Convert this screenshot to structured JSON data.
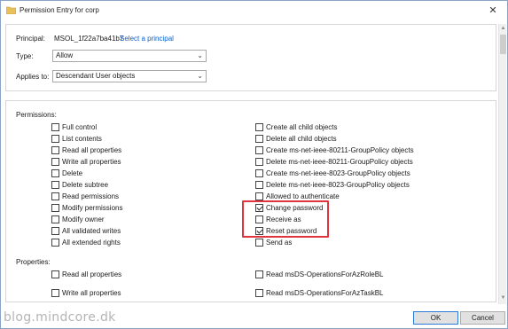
{
  "window": {
    "title": "Permission Entry for corp"
  },
  "principal": {
    "label": "Principal:",
    "value": "MSOL_1f22a7ba41b7",
    "link": "Select a principal"
  },
  "type": {
    "label": "Type:",
    "value": "Allow"
  },
  "applies_to": {
    "label": "Applies to:",
    "value": "Descendant User objects"
  },
  "permissions": {
    "heading": "Permissions:",
    "left": [
      {
        "label": "Full control",
        "checked": false
      },
      {
        "label": "List contents",
        "checked": false
      },
      {
        "label": "Read all properties",
        "checked": false
      },
      {
        "label": "Write all properties",
        "checked": false
      },
      {
        "label": "Delete",
        "checked": false
      },
      {
        "label": "Delete subtree",
        "checked": false
      },
      {
        "label": "Read permissions",
        "checked": false
      },
      {
        "label": "Modify permissions",
        "checked": false
      },
      {
        "label": "Modify owner",
        "checked": false
      },
      {
        "label": "All validated writes",
        "checked": false
      },
      {
        "label": "All extended rights",
        "checked": false
      }
    ],
    "right": [
      {
        "label": "Create all child objects",
        "checked": false
      },
      {
        "label": "Delete all child objects",
        "checked": false
      },
      {
        "label": "Create ms-net-ieee-80211-GroupPolicy objects",
        "checked": false
      },
      {
        "label": "Delete ms-net-ieee-80211-GroupPolicy objects",
        "checked": false
      },
      {
        "label": "Create ms-net-ieee-8023-GroupPolicy objects",
        "checked": false
      },
      {
        "label": "Delete ms-net-ieee-8023-GroupPolicy objects",
        "checked": false
      },
      {
        "label": "Allowed to authenticate",
        "checked": false
      },
      {
        "label": "Change password",
        "checked": true
      },
      {
        "label": "Receive as",
        "checked": false
      },
      {
        "label": "Reset password",
        "checked": true
      },
      {
        "label": "Send as",
        "checked": false
      }
    ]
  },
  "properties": {
    "heading": "Properties:",
    "left": [
      {
        "label": "Read all properties",
        "checked": false
      },
      {
        "label": "Write all properties",
        "checked": false
      }
    ],
    "right": [
      {
        "label": "Read msDS-OperationsForAzRoleBL",
        "checked": false
      },
      {
        "label": "Read msDS-OperationsForAzTaskBL",
        "checked": false
      }
    ]
  },
  "buttons": {
    "ok": "OK",
    "cancel": "Cancel"
  },
  "watermark": "blog.mindcore.dk",
  "colors": {
    "highlight": "#e0343e",
    "link": "#0b5fc9",
    "ok_border": "#2a7cd6"
  },
  "icons": {
    "app": "folder-icon",
    "close": "close-icon",
    "dropdown": "chevron-down-icon"
  }
}
